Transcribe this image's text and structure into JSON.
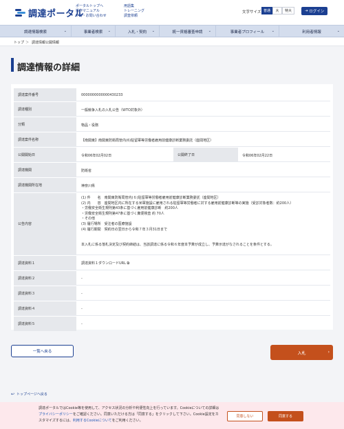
{
  "header": {
    "logo_text": "調達ポータル",
    "links_col1": [
      "ポータルトップへ",
      "操作マニュアル",
      "FAQ・お問い合わせ"
    ],
    "links_col2": [
      "用語集",
      "トレーニング",
      "調査依頼"
    ],
    "font_size_label": "文字サイズ",
    "font_sizes": [
      "普通",
      "大",
      "特大"
    ],
    "login_label": "ログイン"
  },
  "nav": {
    "items": [
      "調達情報検索",
      "事業者検索",
      "入札・契約",
      "統一資格審査申請",
      "事業者プロフィール",
      "利用者情報"
    ]
  },
  "breadcrumb": {
    "top": "トップ",
    "separator": "＞",
    "current": "調達情報公開情報"
  },
  "page_title": "調達情報の詳細",
  "detail": {
    "case_number_label": "調達案件番号",
    "case_number": "0000000000000430233",
    "type_label": "調達種別",
    "type": "一般競争入札の入札公告（WTO対象外）",
    "category_label": "分類",
    "category": "物品・役務",
    "name_label": "調達案件名称",
    "name": "【南関東】南関東防衛局管内(6)駐留軍等労働者雇用前健康診断業務委託（座間地区）",
    "start_label": "公開開始日",
    "start": "令和06年02月02日",
    "end_label": "公開終了日",
    "end": "令和06年02月22日",
    "agency_label": "調達機関",
    "agency": "防衛省",
    "location_label": "調達機関所在地",
    "location": "神奈川県",
    "notice_label": "公告内容",
    "notice_lines": [
      "(1) 件　　名　南関東防衛局管内(６)駐留軍等労働者雇用前健康診断業務委託（座間地区）",
      "(2) 内　　容　座間地区内に所在する米軍施設に雇用される駐留軍等労働者に対する雇用前健康診断等の実施（受診対象者数：約200人）",
      "・労働安全衛生規則第43条に基づく雇用前健康診断　約200人",
      "・労働安全衛生規則第47条に基づく糞便検査 約 70人",
      "・その他",
      "(3) 履行場所　受注者の医療施設",
      "(4) 履行期間　契約日の翌日から令和７年３月31日まで"
    ],
    "notice_footer": "本入札に係る落札決定及び契約締結は、当該調達に係る令和６年度本予算が成立し、予算示達がなされることを条件とする。",
    "material1_label": "調達資料１",
    "material1": "調達資料１ダウンロードURL",
    "material2_label": "調達資料２",
    "material2": "-",
    "material3_label": "調達資料３",
    "material3": "-",
    "material4_label": "調達資料４",
    "material4": "-",
    "material5_label": "調達資料５",
    "material5": "-"
  },
  "buttons": {
    "back": "一覧へ戻る",
    "bid": "入札"
  },
  "to_top": "トップページへ戻る",
  "cookie": {
    "text_a": "調達ポータルではCookie等を使用して、アクセス状況の分析や利便性向上を行っています。Cookieについての詳細は",
    "privacy_link": "プライバシーポリシー",
    "text_b": "をご確認ください。同意いただける方は「同意する」をクリックして下さい。Cookie設定をカスタマイズするには、",
    "cookie_link": "利用するCookieについて",
    "text_c": "をご利用ください。",
    "decline": "同意しない",
    "accept": "同意する"
  },
  "colors": {
    "brand": "#1b3f91",
    "accent": "#c4501c",
    "cookie_bg": "#fde8ec"
  }
}
